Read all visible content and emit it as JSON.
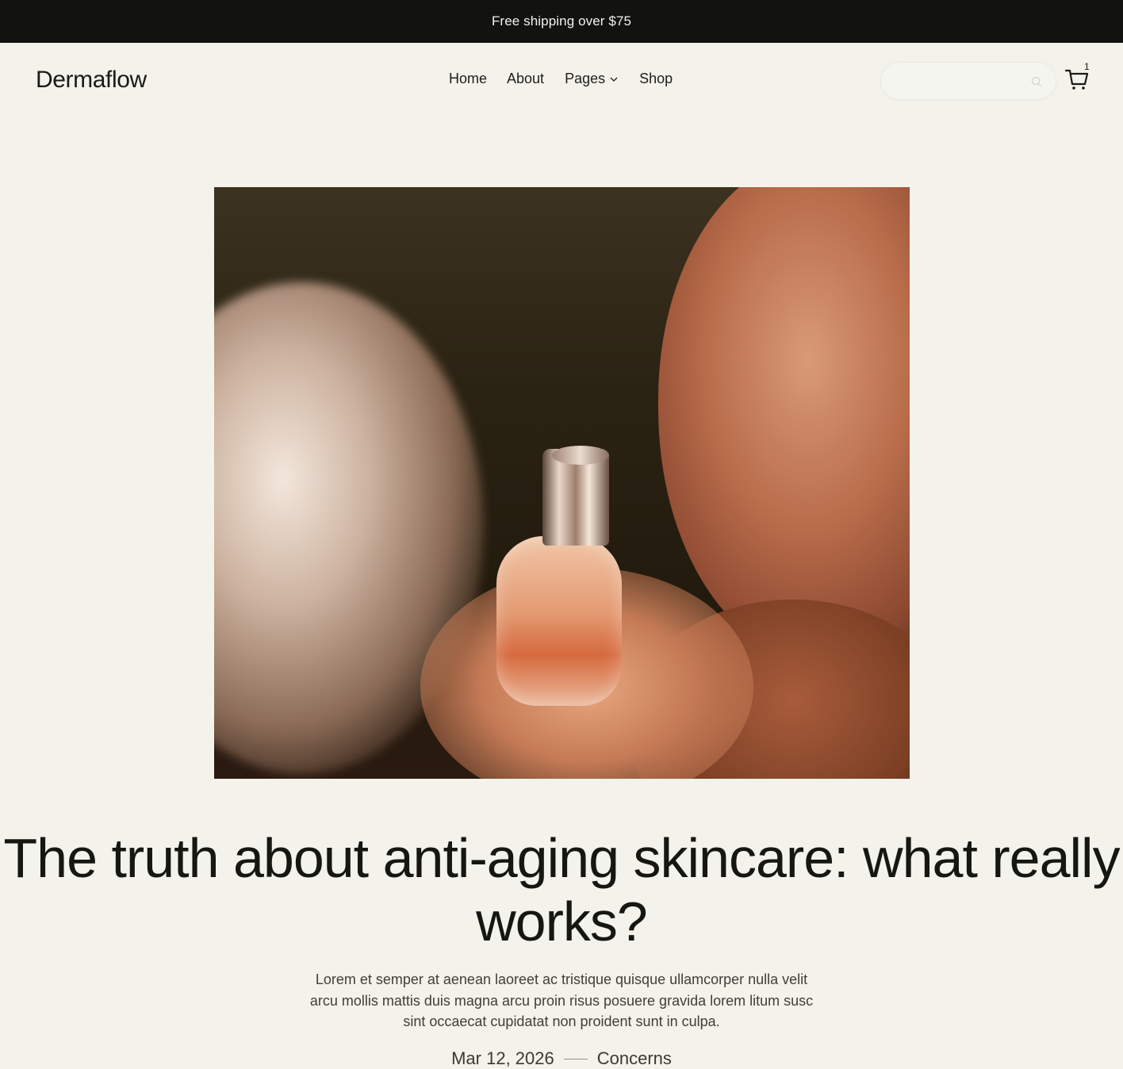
{
  "promo": {
    "text": "Free shipping over $75"
  },
  "header": {
    "logo": "Dermaflow",
    "nav": [
      {
        "label": "Home"
      },
      {
        "label": "About"
      },
      {
        "label": "Pages",
        "icon": "chevron-down-icon"
      },
      {
        "label": "Shop"
      }
    ],
    "search": {
      "placeholder": "",
      "value": "",
      "icon": "search-icon"
    },
    "cart": {
      "icon": "cart-icon",
      "count": "1"
    }
  },
  "article": {
    "image_description": "",
    "title": "The truth about anti-aging skincare: what really works?",
    "excerpt": "Lorem et semper at aenean laoreet ac tristique quisque ullamcorper nulla velit arcu mollis mattis duis magna arcu proin risus posuere gravida lorem litum susc sint occaecat cupidatat non proident sunt in culpa.",
    "date": "Mar 12, 2026",
    "category": "Concerns"
  },
  "colors": {
    "background": "#f3f3ec",
    "promo_bar": "#121210",
    "text": "#161612"
  }
}
